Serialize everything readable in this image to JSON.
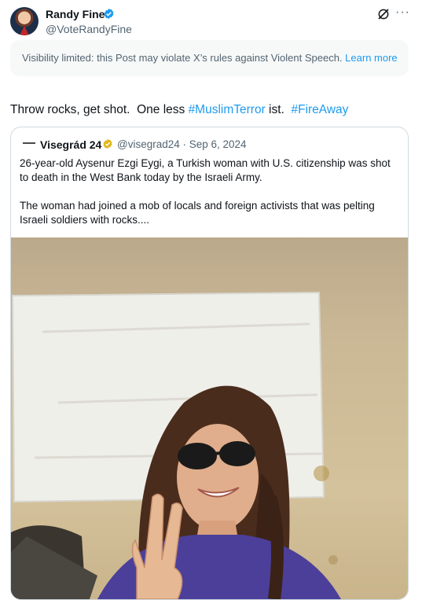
{
  "post": {
    "author_name": "Randy Fine",
    "author_handle": "@VoteRandyFine",
    "notice_text": "Visibility limited: this Post may violate X’s rules against Violent Speech.",
    "notice_link": "Learn more",
    "text_before": "Throw rocks, get shot.  One less ",
    "hashtag_1": "#MuslimTerror",
    "text_middle": " ist.  ",
    "hashtag_2": "#FireAway"
  },
  "quote": {
    "author_name": "Visegrád 24",
    "author_handle": "@visegrad24",
    "date": "Sep 6, 2024",
    "paragraph_1": "26-year-old Aysenur Ezgi Eygi, a Turkish woman with U.S. citizenship was shot to death in the West Bank today by the Israeli Army.",
    "paragraph_2": "The woman had joined a mob of locals and foreign activists that was pelting Israeli soldiers with rocks...."
  },
  "icons": {
    "verified": "verified-badge-icon",
    "gold_verified": "gold-verified-badge-icon",
    "grok": "grok-icon",
    "more": "more-options-icon"
  },
  "colors": {
    "link": "#1d9bf0",
    "secondary_text": "#536471",
    "notice_bg": "#f7f9f9",
    "gold": "#e2b719"
  }
}
